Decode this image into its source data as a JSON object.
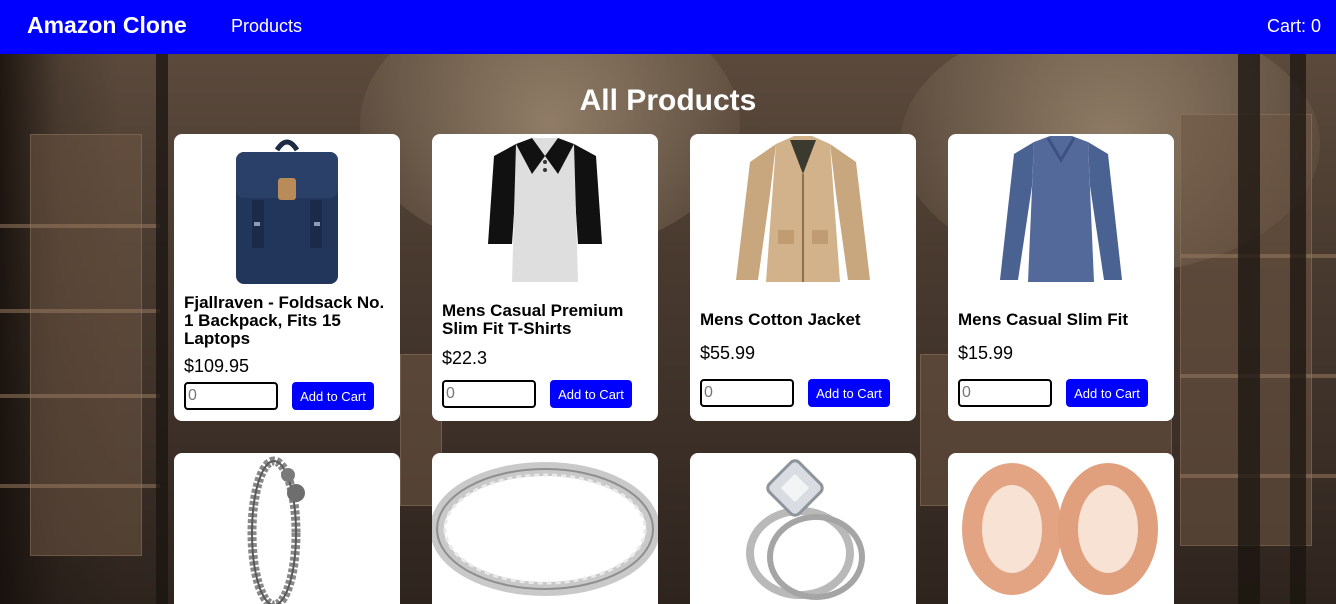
{
  "header": {
    "brand": "Amazon Clone",
    "nav_products": "Products",
    "cart": "Cart: 0",
    "accent_color": "#0000fe"
  },
  "main": {
    "title": "All Products"
  },
  "products": [
    {
      "name": "Fjallraven - Foldsack No. 1 Backpack, Fits 15 Laptops",
      "price": "$109.95",
      "qty_placeholder": "0",
      "add_label": "Add to Cart",
      "image": "backpack"
    },
    {
      "name": "Mens Casual Premium Slim Fit T-Shirts",
      "price": "$22.3",
      "qty_placeholder": "0",
      "add_label": "Add to Cart",
      "image": "raglan-tshirt"
    },
    {
      "name": "Mens Cotton Jacket",
      "price": "$55.99",
      "qty_placeholder": "0",
      "add_label": "Add to Cart",
      "image": "jacket"
    },
    {
      "name": "Mens Casual Slim Fit",
      "price": "$15.99",
      "qty_placeholder": "0",
      "add_label": "Add to Cart",
      "image": "long-sleeve-shirt"
    },
    {
      "image": "dragon-bracelet"
    },
    {
      "image": "silver-ring"
    },
    {
      "image": "diamond-ring-set"
    },
    {
      "image": "rose-gold-plugs"
    }
  ]
}
